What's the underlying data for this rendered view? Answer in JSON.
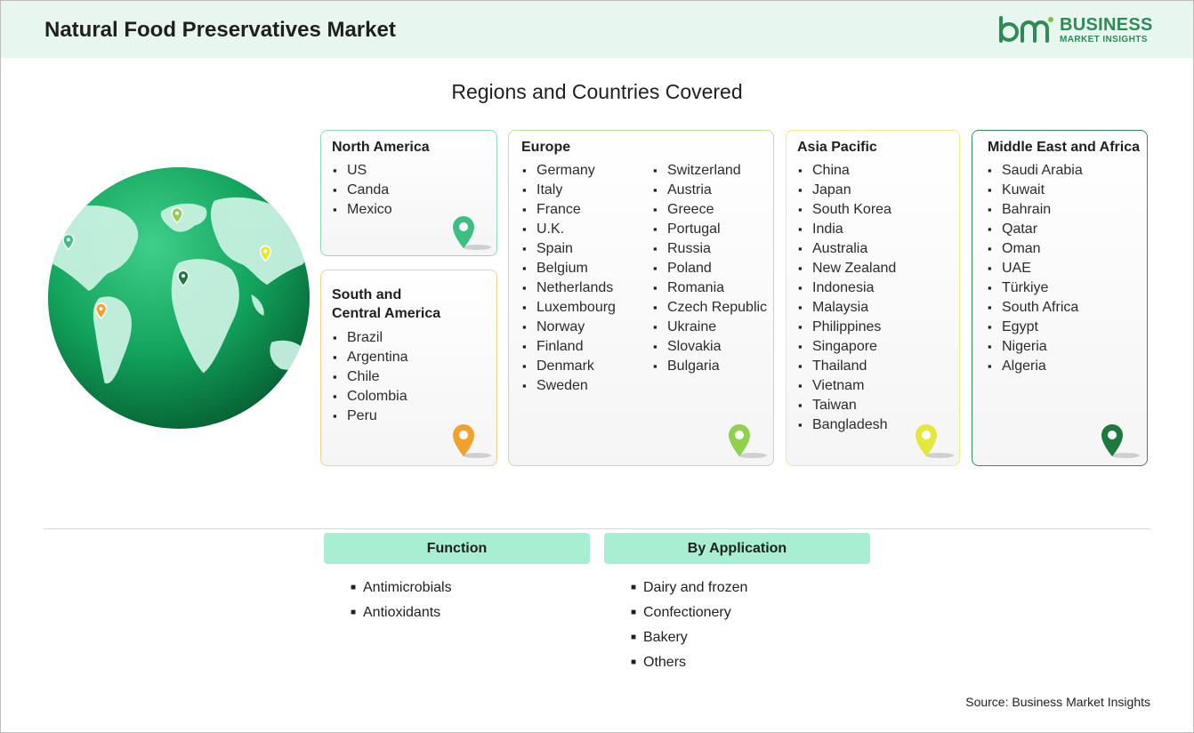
{
  "header": {
    "title": "Natural Food Preservatives Market",
    "logo_line1": "BUSINESS",
    "logo_line2": "MARKET INSIGHTS",
    "logo_mark": "bmi"
  },
  "section_title": "Regions and Countries Covered",
  "regions": {
    "north_america": {
      "title": "North America",
      "countries": [
        "US",
        "Canda",
        "Mexico"
      ],
      "pin_color": "#3cbf82"
    },
    "south_central_america": {
      "title_line1": "South and",
      "title_line2": "Central America",
      "countries": [
        "Brazil",
        "Argentina",
        "Chile",
        "Colombia",
        "Peru"
      ],
      "pin_color": "#f2a12e"
    },
    "europe": {
      "title": "Europe",
      "countries_col1": [
        "Germany",
        "Italy",
        "France",
        "U.K.",
        "Spain",
        "Belgium",
        "Netherlands",
        "Luxembourg",
        "Norway",
        "Finland",
        "Denmark",
        "Sweden"
      ],
      "countries_col2": [
        "Switzerland",
        "Austria",
        "Greece",
        "Portugal",
        "Russia",
        "Poland",
        "Romania",
        "Czech Republic",
        "Ukraine",
        "Slovakia",
        "Bulgaria"
      ],
      "pin_color": "#8fd14f"
    },
    "asia_pacific": {
      "title": "Asia Pacific",
      "countries": [
        "China",
        "Japan",
        "South Korea",
        "India",
        "Australia",
        "New Zealand",
        "Indonesia",
        "Malaysia",
        "Philippines",
        "Singapore",
        "Thailand",
        "Vietnam",
        "Taiwan",
        "Bangladesh"
      ],
      "pin_color": "#e4e83a"
    },
    "middle_east_africa": {
      "title": "Middle East and Africa",
      "countries": [
        "Saudi Arabia",
        "Kuwait",
        "Bahrain",
        "Qatar",
        "Oman",
        "UAE",
        "Türkiye",
        "South Africa",
        "Egypt",
        "Nigeria",
        "Algeria"
      ],
      "pin_color": "#1e7a3c"
    }
  },
  "segments": {
    "function": {
      "title": "Function",
      "items": [
        "Antimicrobials",
        "Antioxidants"
      ]
    },
    "application": {
      "title": "By Application",
      "items": [
        "Dairy and frozen",
        "Confectionery",
        "Bakery",
        "Others"
      ]
    }
  },
  "source": "Source: Business Market Insights",
  "colors": {
    "header_bg": "#e7f6ef",
    "brand_green": "#2e8b57",
    "segment_header_bg": "#a8eed2",
    "border_north_america": "#8fdcb2",
    "border_south_america": "#f6cf94",
    "border_europe": "#b9e59a",
    "border_asia_pacific": "#eef08a",
    "border_middle_east_africa": "#2f8f55"
  }
}
